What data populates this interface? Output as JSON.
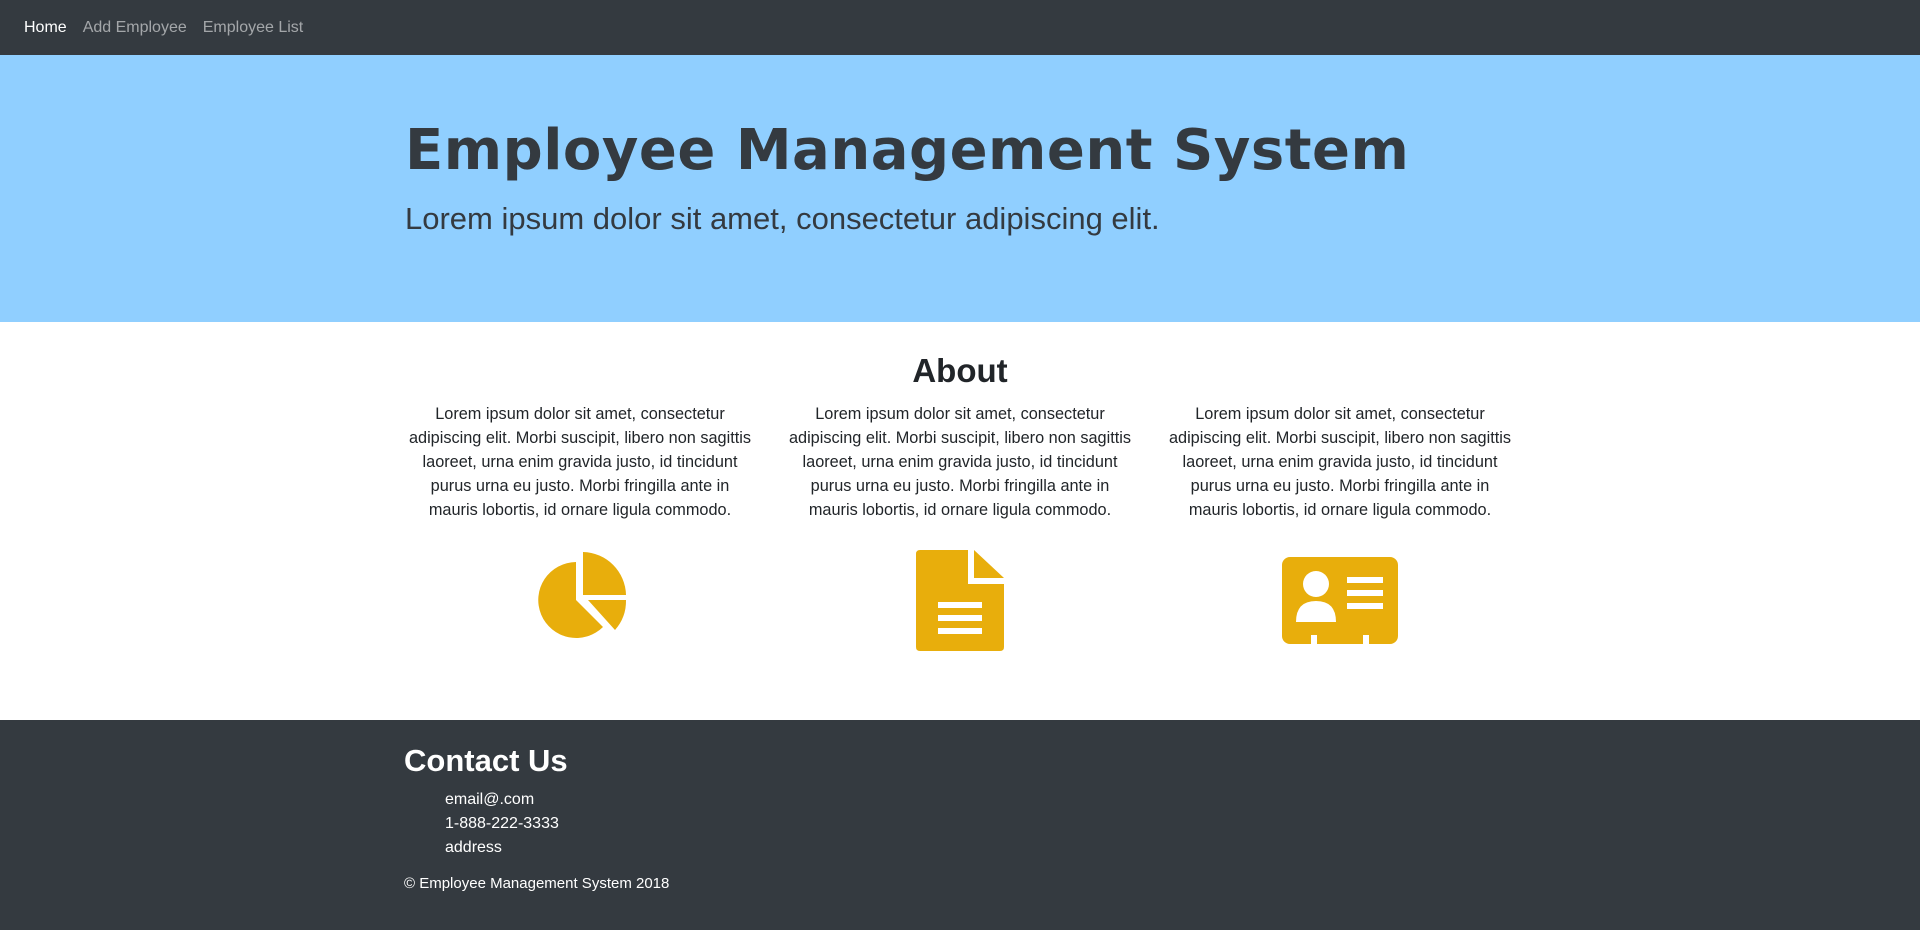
{
  "nav": {
    "items": [
      {
        "label": "Home",
        "active": true
      },
      {
        "label": "Add Employee",
        "active": false
      },
      {
        "label": "Employee List",
        "active": false
      }
    ]
  },
  "hero": {
    "title": "Employee Management System",
    "subtitle": "Lorem ipsum dolor sit amet, consectetur adipiscing elit."
  },
  "about": {
    "title": "About",
    "columns": [
      {
        "text": "Lorem ipsum dolor sit amet, consectetur adipiscing elit. Morbi suscipit, libero non sagittis laoreet, urna enim gravida justo, id tincidunt purus urna eu justo. Morbi fringilla ante in mauris lobortis, id ornare ligula commodo.",
        "icon": "pie-chart-icon"
      },
      {
        "text": "Lorem ipsum dolor sit amet, consectetur adipiscing elit. Morbi suscipit, libero non sagittis laoreet, urna enim gravida justo, id tincidunt purus urna eu justo. Morbi fringilla ante in mauris lobortis, id ornare ligula commodo.",
        "icon": "document-icon"
      },
      {
        "text": "Lorem ipsum dolor sit amet, consectetur adipiscing elit. Morbi suscipit, libero non sagittis laoreet, urna enim gravida justo, id tincidunt purus urna eu justo. Morbi fringilla ante in mauris lobortis, id ornare ligula commodo.",
        "icon": "id-card-icon"
      }
    ]
  },
  "footer": {
    "contact_title": "Contact Us",
    "contacts": [
      "email@.com",
      "1-888-222-3333",
      "address"
    ],
    "copyright": "© Employee Management System 2018"
  },
  "colors": {
    "navbar": "#343a40",
    "hero_bg": "#90cfff",
    "icon_accent": "#e8ae0c",
    "footer": "#343a40"
  }
}
